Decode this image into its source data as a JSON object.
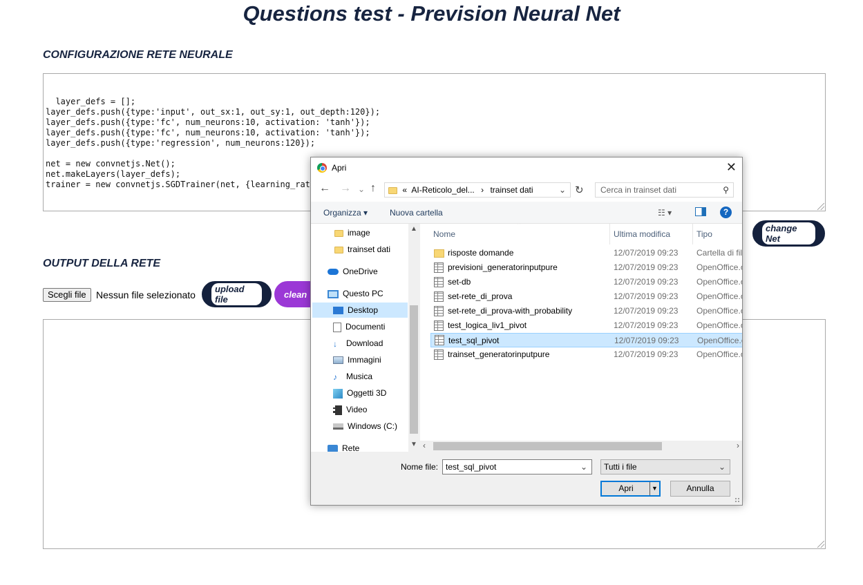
{
  "page": {
    "title": "Questions test - Prevision Neural Net",
    "config_section": "CONFIGURAZIONE RETE NEURALE",
    "config_code": "layer_defs = [];\nlayer_defs.push({type:'input', out_sx:1, out_sy:1, out_depth:120});\nlayer_defs.push({type:'fc', num_neurons:10, activation: 'tanh'});\nlayer_defs.push({type:'fc', num_neurons:10, activation: 'tanh'});\nlayer_defs.push({type:'regression', num_neurons:120});\n\nnet = new convnetjs.Net();\nnet.makeLayers(layer_defs);\ntrainer = new convnetjs.SGDTrainer(net, {learning_rat",
    "change_net_label": "change Net",
    "output_section": "OUTPUT DELLA RETE",
    "choose_file_label": "Scegli file",
    "no_file_label": "Nessun file selezionato",
    "upload_label": "upload file",
    "clean_label": "clean"
  },
  "dialog": {
    "title": "Apri",
    "close": "✕",
    "breadcrumb": {
      "prefix": "«",
      "parent": "AI-Reticolo_del...",
      "separator": "›",
      "current": "trainset dati"
    },
    "search_placeholder": "Cerca in trainset dati",
    "toolbar": {
      "organize": "Organizza",
      "new_folder": "Nuova cartella"
    },
    "nav_items": [
      {
        "label": "image"
      },
      {
        "label": "trainset dati"
      },
      {
        "label": "OneDrive"
      },
      {
        "label": "Questo PC"
      },
      {
        "label": "Desktop"
      },
      {
        "label": "Documenti"
      },
      {
        "label": "Download"
      },
      {
        "label": "Immagini"
      },
      {
        "label": "Musica"
      },
      {
        "label": "Oggetti 3D"
      },
      {
        "label": "Video"
      },
      {
        "label": "Windows (C:)"
      },
      {
        "label": "Rete"
      }
    ],
    "columns": {
      "name": "Nome",
      "modified": "Ultima modifica",
      "type": "Tipo"
    },
    "files": [
      {
        "name": "risposte domande",
        "date": "12/07/2019 09:23",
        "type": "Cartella di file"
      },
      {
        "name": "previsioni_generatorinputpure",
        "date": "12/07/2019 09:23",
        "type": "OpenOffice.o"
      },
      {
        "name": "set-db",
        "date": "12/07/2019 09:23",
        "type": "OpenOffice.o"
      },
      {
        "name": "set-rete_di_prova",
        "date": "12/07/2019 09:23",
        "type": "OpenOffice.o"
      },
      {
        "name": "set-rete_di_prova-with_probability",
        "date": "12/07/2019 09:23",
        "type": "OpenOffice.o"
      },
      {
        "name": "test_logica_liv1_pivot",
        "date": "12/07/2019 09:23",
        "type": "OpenOffice.o"
      },
      {
        "name": "test_sql_pivot",
        "date": "12/07/2019 09:23",
        "type": "OpenOffice.o"
      },
      {
        "name": "trainset_generatorinputpure",
        "date": "12/07/2019 09:23",
        "type": "OpenOffice.o"
      }
    ],
    "filename_label": "Nome file:",
    "filename_value": "test_sql_pivot",
    "filetype_value": "Tutti i file",
    "open_label": "Apri",
    "cancel_label": "Annulla"
  }
}
